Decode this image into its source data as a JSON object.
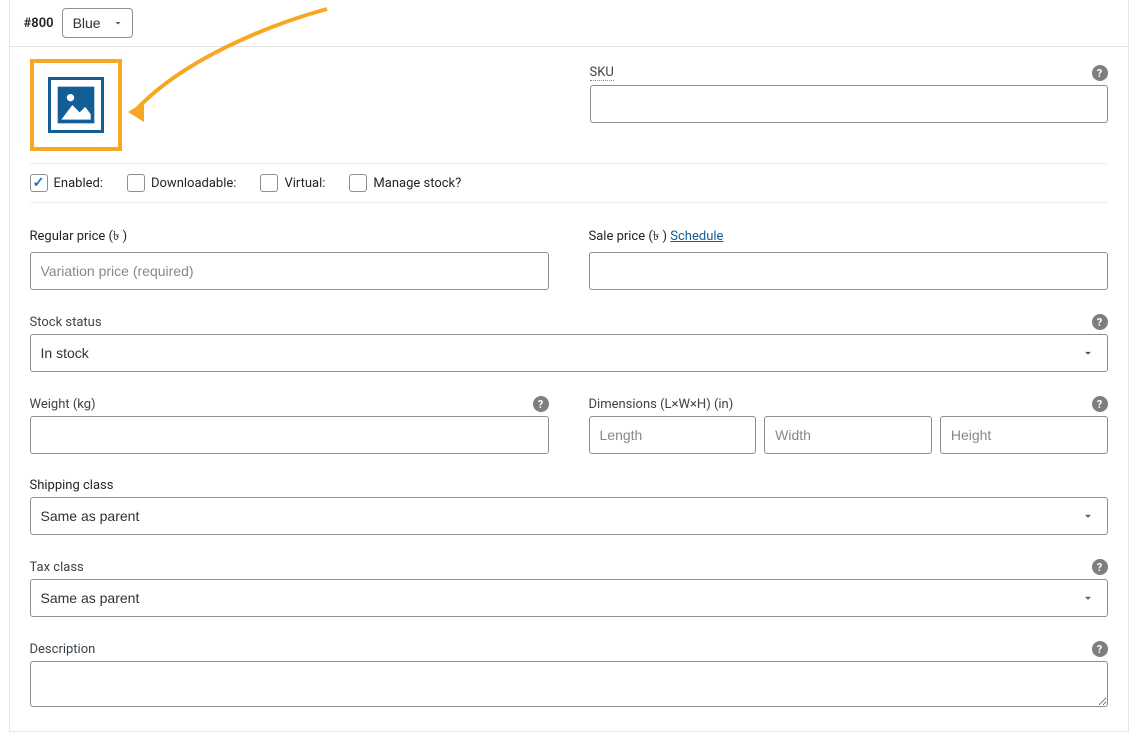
{
  "variation": {
    "id_label": "#800",
    "attribute_option": "Blue"
  },
  "checkboxes": {
    "enabled": {
      "label": "Enabled:",
      "checked": true
    },
    "downloadable": {
      "label": "Downloadable:",
      "checked": false
    },
    "virtual": {
      "label": "Virtual:",
      "checked": false
    },
    "manage_stock": {
      "label": "Manage stock?",
      "checked": false
    }
  },
  "fields": {
    "sku": {
      "label": "SKU",
      "value": ""
    },
    "regular_price": {
      "label": "Regular price (৳ )",
      "placeholder": "Variation price (required)",
      "value": ""
    },
    "sale_price": {
      "label": "Sale price (৳ )",
      "schedule_label": "Schedule",
      "value": ""
    },
    "stock_status": {
      "label": "Stock status",
      "value": "In stock"
    },
    "weight": {
      "label": "Weight (kg)",
      "value": ""
    },
    "dimensions": {
      "label": "Dimensions (L×W×H) (in)",
      "length_placeholder": "Length",
      "width_placeholder": "Width",
      "height_placeholder": "Height",
      "length": "",
      "width": "",
      "height": ""
    },
    "shipping_class": {
      "label": "Shipping class",
      "value": "Same as parent"
    },
    "tax_class": {
      "label": "Tax class",
      "value": "Same as parent"
    },
    "description": {
      "label": "Description",
      "value": ""
    }
  },
  "help": "?"
}
